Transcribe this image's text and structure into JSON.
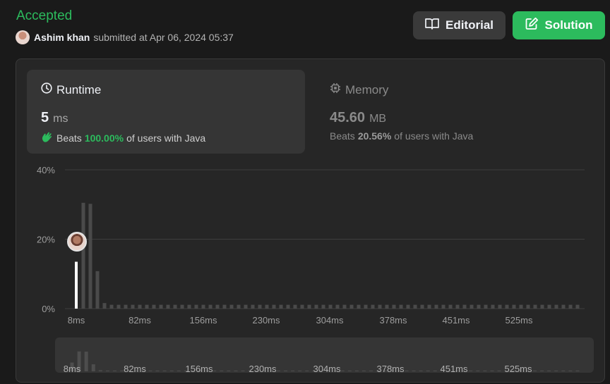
{
  "status": "Accepted",
  "submission": {
    "author": "Ashim khan",
    "submitted_text": "submitted at Apr 06, 2024 05:37"
  },
  "buttons": {
    "editorial": "Editorial",
    "solution": "Solution"
  },
  "runtime": {
    "title": "Runtime",
    "value": "5",
    "unit": "ms",
    "beats_label": "Beats",
    "beats_pct": "100.00%",
    "beats_suffix": "of users with Java"
  },
  "memory": {
    "title": "Memory",
    "value": "45.60",
    "unit": "MB",
    "beats_label": "Beats",
    "beats_pct": "20.56%",
    "beats_suffix": "of users with Java"
  },
  "colors": {
    "accepted": "#2cbb5d",
    "solution_button": "#2cbb5d",
    "bar": "#4a4a4a",
    "highlight_bar": "#ffffff"
  },
  "chart_data": {
    "type": "bar",
    "y_ticks": [
      "40%",
      "20%",
      "0%"
    ],
    "x_ticks": [
      "8ms",
      "82ms",
      "156ms",
      "230ms",
      "304ms",
      "378ms",
      "451ms",
      "525ms"
    ],
    "ylim": [
      0,
      40
    ],
    "grid": true,
    "highlight": {
      "x": "5ms",
      "y": 13.5
    },
    "bins": 72,
    "values": [
      13.5,
      30.5,
      30.2,
      10.8,
      1.6,
      1.1,
      1.1,
      1.1,
      1.1,
      1.1,
      1.1,
      1.1,
      1.1,
      1.1,
      1.1,
      1.1,
      1.1,
      1.1,
      1.1,
      1.1,
      1.1,
      1.1,
      1.1,
      1.1,
      1.1,
      1.1,
      1.1,
      1.1,
      1.1,
      1.1,
      1.1,
      1.1,
      1.1,
      1.1,
      1.1,
      1.1,
      1.1,
      1.1,
      1.1,
      1.1,
      1.1,
      1.1,
      1.1,
      1.1,
      1.1,
      1.1,
      1.1,
      1.1,
      1.1,
      1.1,
      1.1,
      1.1,
      1.1,
      1.1,
      1.1,
      1.1,
      1.1,
      1.1,
      1.1,
      1.1,
      1.1,
      1.1,
      1.1,
      1.1,
      1.1,
      1.1,
      1.1,
      1.1,
      1.1,
      1.1,
      1.1,
      1.1
    ]
  }
}
